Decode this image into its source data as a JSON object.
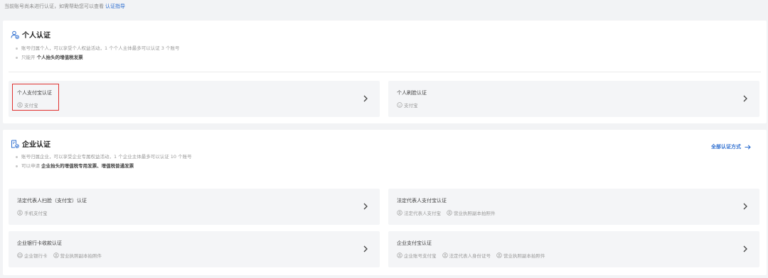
{
  "notice": {
    "text": "当前账号尚未进行认证，如需帮助您可以查看",
    "link": "认证指导"
  },
  "colors": {
    "accent": "#2f6fd0",
    "highlight_border": "#e0312f",
    "tile_bg": "#f4f5f7"
  },
  "personal": {
    "title": "个人认证",
    "bullets": [
      {
        "text": "账号归属个人，可以享受个人权益活动，1 个个人主体最多可以认证 3 个账号",
        "bold": ""
      },
      {
        "text": "只能开 ",
        "bold": "个人抬头的增值税发票"
      }
    ],
    "options": [
      {
        "label": "个人支付宝认证",
        "subs": [
          {
            "icon": "person-circle-icon",
            "text": "支付宝"
          }
        ]
      },
      {
        "label": "个人刷脸认证",
        "subs": [
          {
            "icon": "face-icon",
            "text": "支付宝"
          }
        ]
      }
    ]
  },
  "enterprise": {
    "title": "企业认证",
    "all_methods": "全部认证方式",
    "bullets": [
      {
        "text": "账号归属企业，可以享受企业专属权益活动，1 个企业主体最多可以认证 10 个账号",
        "bold": ""
      },
      {
        "text": "可以申请 ",
        "bold": "企业抬头的增值税专用发票、增值税普通发票"
      }
    ],
    "options": [
      {
        "label": "法定代表人扫脸（支付宝）认证",
        "subs": [
          {
            "icon": "person-circle-icon",
            "text": "手机支付宝"
          }
        ]
      },
      {
        "label": "法定代表人支付宝认证",
        "subs": [
          {
            "icon": "person-circle-icon",
            "text": "法定代表人支付宝"
          },
          {
            "icon": "person-circle-icon",
            "text": "营业执照副本拍照件"
          }
        ]
      },
      {
        "label": "企业银行卡收款认证",
        "subs": [
          {
            "icon": "bank-card-icon",
            "text": "企业银行卡"
          },
          {
            "icon": "person-circle-icon",
            "text": "营业执照副本拍照件"
          }
        ]
      },
      {
        "label": "企业支付宝认证",
        "subs": [
          {
            "icon": "person-circle-icon",
            "text": "企业账号支付宝"
          },
          {
            "icon": "person-circle-icon",
            "text": "法定代表人身份证号"
          },
          {
            "icon": "person-circle-icon",
            "text": "营业执照副本拍照件"
          }
        ]
      }
    ]
  }
}
